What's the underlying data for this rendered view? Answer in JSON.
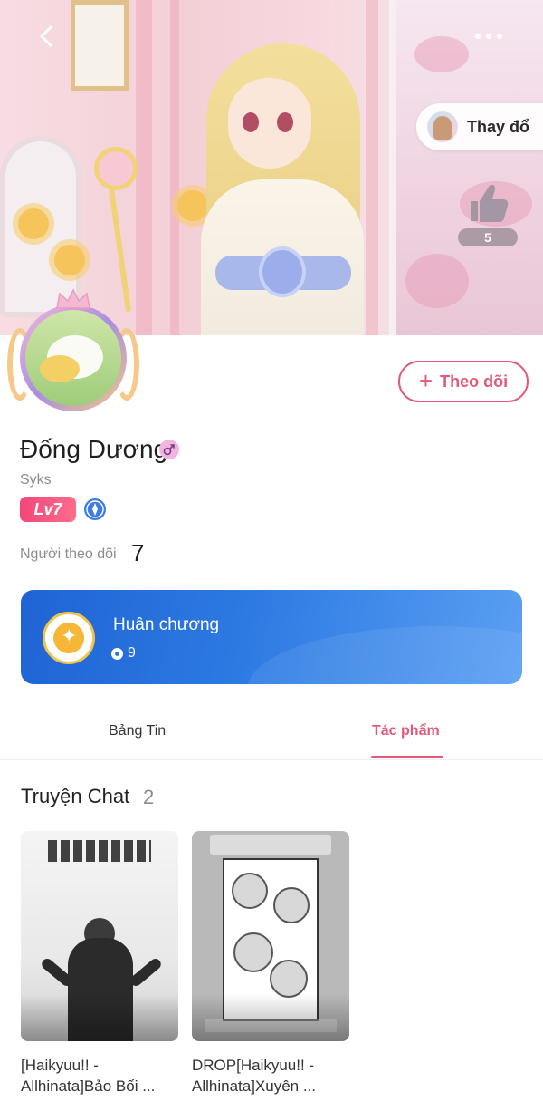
{
  "header": {
    "back_icon": "chevron-left-icon",
    "more_icon": "more-horizontal-icon",
    "change_outfit_label": "Thay đổ",
    "like_count": "5"
  },
  "profile": {
    "follow_button_label": "Theo dõi",
    "name": "Đống Dương",
    "handle": "Syks",
    "level": "Lv7",
    "followers_label": "Người theo dõi",
    "followers_count": "7"
  },
  "medal": {
    "title": "Huân chương",
    "count": "9"
  },
  "tabs": [
    {
      "label": "Bảng Tin",
      "active": false
    },
    {
      "label": "Tác phẩm",
      "active": true
    }
  ],
  "stories": {
    "section_title": "Truyện Chat",
    "count": "2",
    "items": [
      {
        "title": "[Haikyuu!! - Allhinata]Bảo Bối ..."
      },
      {
        "title": "DROP[Haikyuu!! - Allhinata]Xuyên ..."
      }
    ]
  },
  "colors": {
    "accent": "#e35a78",
    "medal_blue": "#2d7ae3",
    "level_pink": "#f2477a"
  }
}
